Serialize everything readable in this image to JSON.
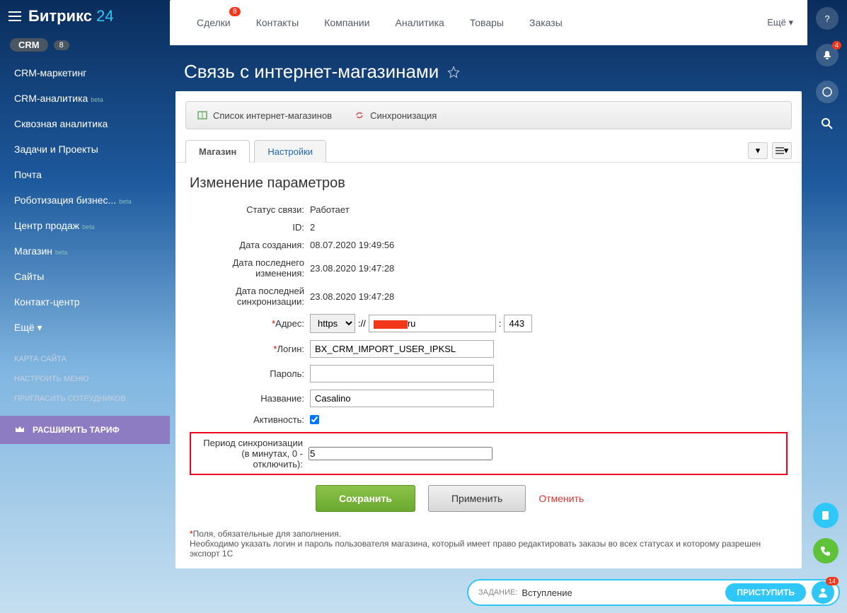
{
  "logo": {
    "text": "Битрикс",
    "suffix": "24"
  },
  "sidebar": {
    "crm_label": "CRM",
    "crm_count": "8",
    "items": [
      {
        "label": "CRM-маркетинг",
        "beta": ""
      },
      {
        "label": "CRM-аналитика",
        "beta": "beta"
      },
      {
        "label": "Сквозная аналитика",
        "beta": ""
      },
      {
        "label": "Задачи и Проекты",
        "beta": ""
      },
      {
        "label": "Почта",
        "beta": ""
      },
      {
        "label": "Роботизация бизнес...",
        "beta": "beta"
      },
      {
        "label": "Центр продаж",
        "beta": "beta"
      },
      {
        "label": "Магазин",
        "beta": "beta"
      },
      {
        "label": "Сайты",
        "beta": ""
      },
      {
        "label": "Контакт-центр",
        "beta": ""
      },
      {
        "label": "Ещё ▾",
        "beta": ""
      }
    ],
    "small": [
      "КАРТА САЙТА",
      "НАСТРОИТЬ МЕНЮ",
      "ПРИГЛАСИТЬ СОТРУДНИКОВ"
    ],
    "expand": "РАСШИРИТЬ ТАРИФ"
  },
  "topnav": {
    "items": [
      {
        "label": "Сделки",
        "badge": "8"
      },
      {
        "label": "Контакты",
        "badge": ""
      },
      {
        "label": "Компании",
        "badge": ""
      },
      {
        "label": "Аналитика",
        "badge": ""
      },
      {
        "label": "Товары",
        "badge": ""
      },
      {
        "label": "Заказы",
        "badge": ""
      }
    ],
    "more": "Ещё ▾"
  },
  "page": {
    "title": "Связь с интернет-магазинами"
  },
  "toolbar": {
    "list": "Список интернет-магазинов",
    "sync": "Синхронизация"
  },
  "tabs": {
    "shop": "Магазин",
    "settings": "Настройки"
  },
  "form": {
    "heading": "Изменение параметров",
    "status_l": "Статус связи:",
    "status_v": "Работает",
    "id_l": "ID:",
    "id_v": "2",
    "created_l": "Дата создания:",
    "created_v": "08.07.2020 19:49:56",
    "modified_l": "Дата последнего изменения:",
    "modified_v": "23.08.2020 19:47:28",
    "synced_l": "Дата последней синхронизации:",
    "synced_v": "23.08.2020 19:47:28",
    "addr_l": "Адрес:",
    "addr_proto": "https",
    "addr_sep1": "://",
    "addr_domain_suffix": "ru",
    "addr_sep2": ":",
    "addr_port": "443",
    "login_l": "Логин:",
    "login_v": "BX_CRM_IMPORT_USER_IPKSL",
    "pass_l": "Пароль:",
    "pass_v": "",
    "name_l": "Название:",
    "name_v": "Casalino",
    "active_l": "Активность:",
    "period_l": "Период синхронизации (в минутах, 0 - отключить):",
    "period_v": "5",
    "save": "Сохранить",
    "apply": "Применить",
    "cancel": "Отменить",
    "footnote1": "Поля, обязательные для заполнения.",
    "footnote2": "Необходимо указать логин и пароль пользователя магазина, который имеет право редактировать заказы во всех статусах и которому разрешен экспорт 1С"
  },
  "rail": {
    "notify_badge": "4"
  },
  "bottombar": {
    "label": "ЗАДАНИЕ:",
    "value": "Вступление",
    "btn": "ПРИСТУПИТЬ",
    "badge": "14"
  }
}
